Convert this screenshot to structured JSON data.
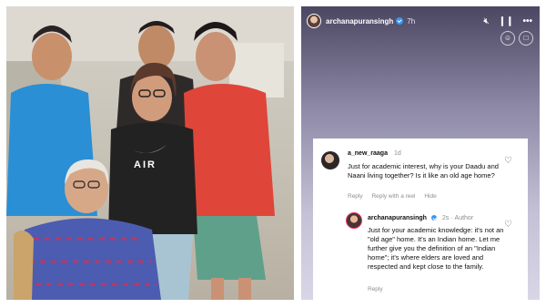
{
  "photo": {
    "shirt_text": "AIR"
  },
  "story": {
    "username": "archanapuransingh",
    "time": "7h"
  },
  "comments": [
    {
      "username": "a_new_raaga",
      "time": "1d",
      "text": "Just for academic interest, why is your Daadu and Naani living together? Is it like an old age home?",
      "actions": [
        "Reply",
        "Reply with a reel",
        "Hide"
      ]
    },
    {
      "username": "archanapuransingh",
      "time": "2s",
      "author_label": "Author",
      "text": "Just for your academic knowledge: it's not an \"old age\" home. It's an Indian home. Let me further give you the definition of an \"Indian home\"; it's where elders are loved and respected and kept close to the family.",
      "actions": [
        "Reply"
      ]
    }
  ]
}
